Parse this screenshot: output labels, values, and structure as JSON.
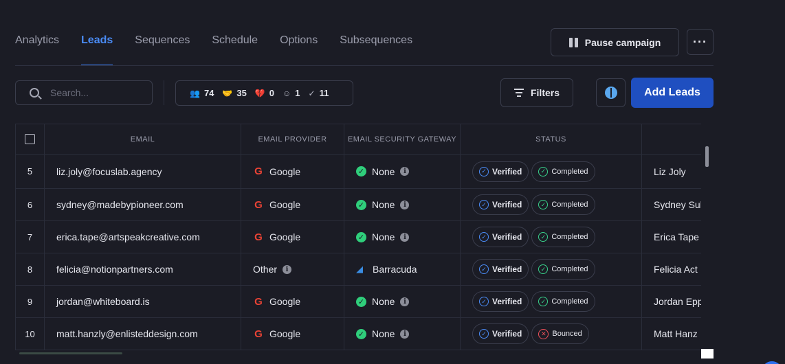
{
  "nav": {
    "tabs": [
      {
        "label": "Analytics",
        "active": false
      },
      {
        "label": "Leads",
        "active": true
      },
      {
        "label": "Sequences",
        "active": false
      },
      {
        "label": "Schedule",
        "active": false
      },
      {
        "label": "Options",
        "active": false
      },
      {
        "label": "Subsequences",
        "active": false
      }
    ]
  },
  "header": {
    "pause_label": "Pause campaign",
    "more_label": "···"
  },
  "toolbar": {
    "search_placeholder": "Search...",
    "stats": [
      {
        "icon": "people-icon",
        "glyph": "👥",
        "value": "74"
      },
      {
        "icon": "handshake-icon",
        "glyph": "🤝",
        "value": "35"
      },
      {
        "icon": "broken-heart-icon",
        "glyph": "💔",
        "value": "0"
      },
      {
        "icon": "dizzy-face-icon",
        "glyph": "☺",
        "value": "1"
      },
      {
        "icon": "check-circle-icon",
        "glyph": "✓",
        "value": "11"
      }
    ],
    "filters_label": "Filters",
    "add_leads_label": "Add Leads"
  },
  "table": {
    "headers": {
      "email": "EMAIL",
      "provider": "EMAIL PROVIDER",
      "gateway": "EMAIL SECURITY GATEWAY",
      "status": "STATUS",
      "name": ""
    },
    "rows": [
      {
        "num": "5",
        "email": "liz.joly@focuslab.agency",
        "provider": "Google",
        "gateway": "None",
        "verified": "Verified",
        "status": "Completed",
        "status_type": "completed",
        "name": "Liz Joly"
      },
      {
        "num": "6",
        "email": "sydney@madebypioneer.com",
        "provider": "Google",
        "gateway": "None",
        "verified": "Verified",
        "status": "Completed",
        "status_type": "completed",
        "name": "Sydney Sul"
      },
      {
        "num": "7",
        "email": "erica.tape@artspeakcreative.com",
        "provider": "Google",
        "gateway": "None",
        "verified": "Verified",
        "status": "Completed",
        "status_type": "completed",
        "name": "Erica Tape"
      },
      {
        "num": "8",
        "email": "felicia@notionpartners.com",
        "provider": "Other",
        "gateway": "Barracuda",
        "verified": "Verified",
        "status": "Completed",
        "status_type": "completed",
        "name": "Felicia Act"
      },
      {
        "num": "9",
        "email": "jordan@whiteboard.is",
        "provider": "Google",
        "gateway": "None",
        "verified": "Verified",
        "status": "Completed",
        "status_type": "completed",
        "name": "Jordan Epp"
      },
      {
        "num": "10",
        "email": "matt.hanzly@enlisteddesign.com",
        "provider": "Google",
        "gateway": "None",
        "verified": "Verified",
        "status": "Bounced",
        "status_type": "bounced",
        "name": "Matt Hanz"
      }
    ]
  },
  "colors": {
    "background": "#1b1c25",
    "accent": "#4a8bf5",
    "primary_button": "#1f4fc0",
    "success": "#38d08a",
    "danger": "#f0515a"
  }
}
